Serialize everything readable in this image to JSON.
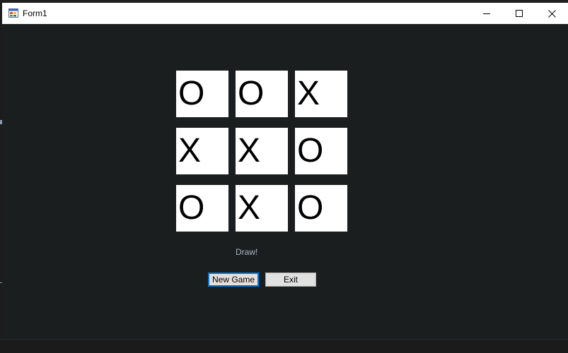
{
  "window": {
    "title": "Form1",
    "minimize_icon": "minimize-icon",
    "maximize_icon": "maximize-icon",
    "close_icon": "close-icon"
  },
  "board": {
    "cells": [
      [
        "O",
        "O",
        "X"
      ],
      [
        "X",
        "X",
        "O"
      ],
      [
        "O",
        "X",
        "O"
      ]
    ]
  },
  "status": {
    "text": "Draw!"
  },
  "buttons": {
    "new_game_label": "New Game",
    "exit_label": "Exit"
  },
  "colors": {
    "background": "#1a1e1e",
    "cell": "#ffffff",
    "status_text": "#a9b7c6",
    "focus_border": "#0078d7"
  }
}
